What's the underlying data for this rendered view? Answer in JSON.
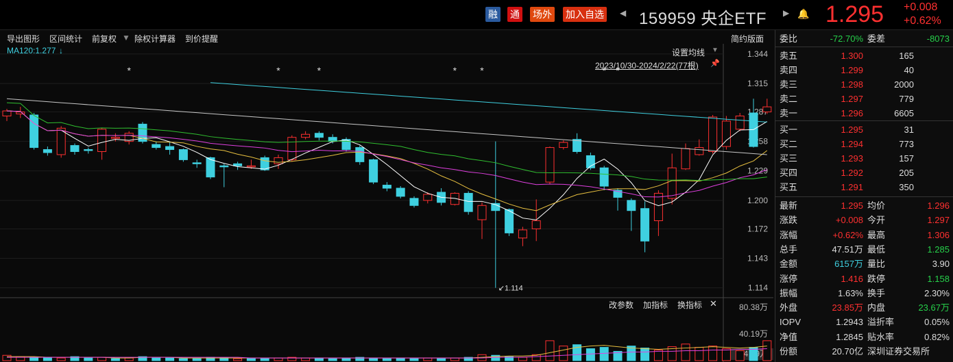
{
  "header": {
    "badge_rong": "融",
    "badge_tong": "通",
    "badge_chang": "场外",
    "badge_add": "加入自选",
    "title": "159959 央企ETF",
    "price": "1.295",
    "change": "+0.008",
    "change_pct": "+0.62%"
  },
  "toolbar": {
    "export": "导出图形",
    "interval_stat": "区间统计",
    "adjust": "前复权",
    "ex_calc": "除权计算器",
    "price_alert": "到价提醒",
    "simple": "简约版面"
  },
  "overlay": {
    "ma_label": "MA120:1.277",
    "set_ma": "设置均线",
    "date_range": "2023/10/30-2024/2/22(77根)",
    "low_marker": "1.114"
  },
  "volume_tools": {
    "params": "改参数",
    "add_ind": "加指标",
    "swap_ind": "换指标",
    "close": "✕"
  },
  "panel": {
    "weibi_label": "委比",
    "weibi": "-72.70%",
    "weicha_label": "委差",
    "weicha": "-8073",
    "asks": [
      {
        "label": "卖五",
        "price": "1.300",
        "vol": "165"
      },
      {
        "label": "卖四",
        "price": "1.299",
        "vol": "40"
      },
      {
        "label": "卖三",
        "price": "1.298",
        "vol": "2000"
      },
      {
        "label": "卖二",
        "price": "1.297",
        "vol": "779"
      },
      {
        "label": "卖一",
        "price": "1.296",
        "vol": "6605"
      }
    ],
    "bids": [
      {
        "label": "买一",
        "price": "1.295",
        "vol": "31"
      },
      {
        "label": "买二",
        "price": "1.294",
        "vol": "773"
      },
      {
        "label": "买三",
        "price": "1.293",
        "vol": "157"
      },
      {
        "label": "买四",
        "price": "1.292",
        "vol": "205"
      },
      {
        "label": "买五",
        "price": "1.291",
        "vol": "350"
      }
    ],
    "stats": [
      {
        "l1": "最新",
        "v1": "1.295",
        "c1": "red",
        "l2": "均价",
        "v2": "1.296",
        "c2": "red"
      },
      {
        "l1": "涨跌",
        "v1": "+0.008",
        "c1": "red",
        "l2": "今开",
        "v2": "1.297",
        "c2": "red"
      },
      {
        "l1": "涨幅",
        "v1": "+0.62%",
        "c1": "red",
        "l2": "最高",
        "v2": "1.306",
        "c2": "red"
      },
      {
        "l1": "总手",
        "v1": "47.51万",
        "c1": "white",
        "l2": "最低",
        "v2": "1.285",
        "c2": "green"
      },
      {
        "l1": "金额",
        "v1": "6157万",
        "c1": "cyan",
        "l2": "量比",
        "v2": "3.90",
        "c2": "white"
      },
      {
        "l1": "涨停",
        "v1": "1.416",
        "c1": "red",
        "l2": "跌停",
        "v2": "1.158",
        "c2": "green"
      },
      {
        "l1": "振幅",
        "v1": "1.63%",
        "c1": "white",
        "l2": "换手",
        "v2": "2.30%",
        "c2": "white"
      },
      {
        "l1": "外盘",
        "v1": "23.85万",
        "c1": "red",
        "l2": "内盘",
        "v2": "23.67万",
        "c2": "green"
      },
      {
        "l1": "IOPV",
        "v1": "1.2943",
        "c1": "white",
        "l2": "溢折率",
        "v2": "0.05%",
        "c2": "white"
      },
      {
        "l1": "净值",
        "v1": "1.2845",
        "c1": "white",
        "l2": "贴水率",
        "v2": "0.82%",
        "c2": "white"
      },
      {
        "l1": "份额",
        "v1": "20.70亿",
        "c1": "white",
        "l2": "深圳证券交易所",
        "v2": "",
        "c2": "white"
      }
    ]
  },
  "colors": {
    "up": "#ff3030",
    "down": "#3fd0e0",
    "ma5": "#ffffff",
    "ma10": "#e8c040",
    "ma20": "#e040e0",
    "ma60": "#30c030",
    "ma120": "#3fd0e0",
    "ma250": "#c8c8c8"
  },
  "chart_data": {
    "type": "candlestick",
    "ylim": [
      1.105,
      1.354
    ],
    "yticks": [
      "1.344",
      "1.315",
      "1.287",
      "1.258",
      "1.229",
      "1.200",
      "1.172",
      "1.143",
      "1.114"
    ],
    "vol_ticks": [
      "80.38万",
      "40.19万",
      "4.59万"
    ],
    "vol_max": 80.38,
    "candles": [
      [
        1.283,
        1.288,
        1.29,
        1.278
      ],
      [
        1.285,
        1.287,
        1.292,
        1.281
      ],
      [
        1.284,
        1.252,
        1.286,
        1.25
      ],
      [
        1.25,
        1.247,
        1.253,
        1.244
      ],
      [
        1.245,
        1.271,
        1.273,
        1.242
      ],
      [
        1.254,
        1.248,
        1.256,
        1.245
      ],
      [
        1.25,
        1.249,
        1.252,
        1.246
      ],
      [
        1.248,
        1.27,
        1.271,
        1.24
      ],
      [
        1.262,
        1.262,
        1.266,
        1.258
      ],
      [
        1.258,
        1.266,
        1.268,
        1.255
      ],
      [
        1.275,
        1.258,
        1.277,
        1.256
      ],
      [
        1.255,
        1.252,
        1.258,
        1.25
      ],
      [
        1.253,
        1.25,
        1.258,
        1.245
      ],
      [
        1.25,
        1.24,
        1.251,
        1.238
      ],
      [
        1.237,
        1.236,
        1.24,
        1.232
      ],
      [
        1.242,
        1.223,
        1.243,
        1.221
      ],
      [
        1.234,
        1.233,
        1.236,
        1.213
      ],
      [
        1.236,
        1.234,
        1.238,
        1.23
      ],
      [
        1.234,
        1.234,
        1.24,
        1.231
      ],
      [
        1.242,
        1.23,
        1.244,
        1.229
      ],
      [
        1.236,
        1.242,
        1.245,
        1.231
      ],
      [
        1.24,
        1.262,
        1.264,
        1.238
      ],
      [
        1.262,
        1.265,
        1.268,
        1.26
      ],
      [
        1.266,
        1.262,
        1.268,
        1.259
      ],
      [
        1.262,
        1.258,
        1.265,
        1.256
      ],
      [
        1.26,
        1.25,
        1.262,
        1.248
      ],
      [
        1.252,
        1.238,
        1.254,
        1.235
      ],
      [
        1.24,
        1.218,
        1.241,
        1.216
      ],
      [
        1.215,
        1.212,
        1.218,
        1.209
      ],
      [
        1.212,
        1.204,
        1.214,
        1.202
      ],
      [
        1.202,
        1.195,
        1.204,
        1.193
      ],
      [
        1.2,
        1.206,
        1.208,
        1.197
      ],
      [
        1.208,
        1.198,
        1.212,
        1.195
      ],
      [
        1.196,
        1.207,
        1.208,
        1.195
      ],
      [
        1.207,
        1.189,
        1.209,
        1.186
      ],
      [
        1.181,
        1.195,
        1.198,
        1.162
      ],
      [
        1.197,
        1.19,
        1.258,
        1.114
      ],
      [
        1.191,
        1.168,
        1.192,
        1.165
      ],
      [
        1.163,
        1.171,
        1.174,
        1.155
      ],
      [
        1.172,
        1.18,
        1.201,
        1.16
      ],
      [
        1.218,
        1.252,
        1.253,
        1.216
      ],
      [
        1.252,
        1.257,
        1.259,
        1.25
      ],
      [
        1.26,
        1.248,
        1.266,
        1.246
      ],
      [
        1.244,
        1.232,
        1.247,
        1.23
      ],
      [
        1.232,
        1.214,
        1.234,
        1.21
      ],
      [
        1.21,
        1.203,
        1.212,
        1.19
      ],
      [
        1.2,
        1.19,
        1.202,
        1.17
      ],
      [
        1.192,
        1.16,
        1.199,
        1.149
      ],
      [
        1.18,
        1.207,
        1.21,
        1.165
      ],
      [
        1.202,
        1.232,
        1.246,
        1.196
      ],
      [
        1.231,
        1.251,
        1.256,
        1.23
      ],
      [
        1.245,
        1.252,
        1.26,
        1.244
      ],
      [
        1.248,
        1.282,
        1.284,
        1.246
      ],
      [
        1.253,
        1.278,
        1.283,
        1.25
      ],
      [
        1.27,
        1.283,
        1.286,
        1.268
      ],
      [
        1.286,
        1.253,
        1.3,
        1.252
      ],
      [
        1.287,
        1.292,
        1.3,
        1.285
      ]
    ],
    "volumes": [
      8,
      6,
      5,
      5,
      4,
      6,
      4,
      5,
      3,
      4,
      6,
      4,
      4,
      3,
      3,
      5,
      4,
      3,
      3,
      3,
      4,
      5,
      4,
      4,
      3,
      4,
      5,
      4,
      3,
      4,
      3,
      4,
      3,
      4,
      5,
      9,
      8,
      6,
      5,
      9,
      30,
      22,
      24,
      18,
      20,
      14,
      22,
      19,
      16,
      21,
      25,
      20,
      22,
      18,
      15,
      20,
      30
    ],
    "vol_up": [
      true,
      true,
      false,
      false,
      true,
      false,
      false,
      true,
      false,
      true,
      false,
      false,
      false,
      false,
      false,
      false,
      false,
      true,
      false,
      false,
      true,
      true,
      true,
      false,
      false,
      false,
      false,
      false,
      false,
      false,
      false,
      true,
      false,
      true,
      false,
      true,
      false,
      false,
      true,
      true,
      true,
      true,
      false,
      false,
      false,
      false,
      false,
      false,
      true,
      true,
      true,
      true,
      true,
      true,
      true,
      false,
      true
    ],
    "vol_ma1": [
      6,
      6,
      6,
      5,
      5,
      5,
      5,
      5,
      4,
      4,
      5,
      5,
      5,
      4,
      4,
      4,
      4,
      4,
      4,
      4,
      4,
      4,
      4,
      4,
      4,
      4,
      4,
      4,
      4,
      4,
      4,
      4,
      4,
      4,
      4,
      5,
      6,
      7,
      7,
      8,
      12,
      16,
      20,
      22,
      23,
      21,
      19,
      18,
      17,
      18,
      19,
      20,
      21,
      20,
      19,
      20,
      22
    ],
    "vol_ma2": [
      5,
      5,
      5,
      5,
      5,
      5,
      5,
      5,
      5,
      5,
      5,
      5,
      5,
      5,
      5,
      5,
      5,
      5,
      4,
      4,
      4,
      4,
      4,
      4,
      4,
      4,
      4,
      4,
      4,
      4,
      4,
      4,
      4,
      4,
      4,
      4,
      5,
      5,
      5,
      6,
      7,
      8,
      9,
      10,
      11,
      12,
      13,
      13,
      14,
      14,
      15,
      15,
      16,
      16,
      17,
      17,
      18
    ],
    "annotations": [
      "*",
      "*",
      "*",
      "*",
      "*",
      "*",
      "*"
    ]
  }
}
